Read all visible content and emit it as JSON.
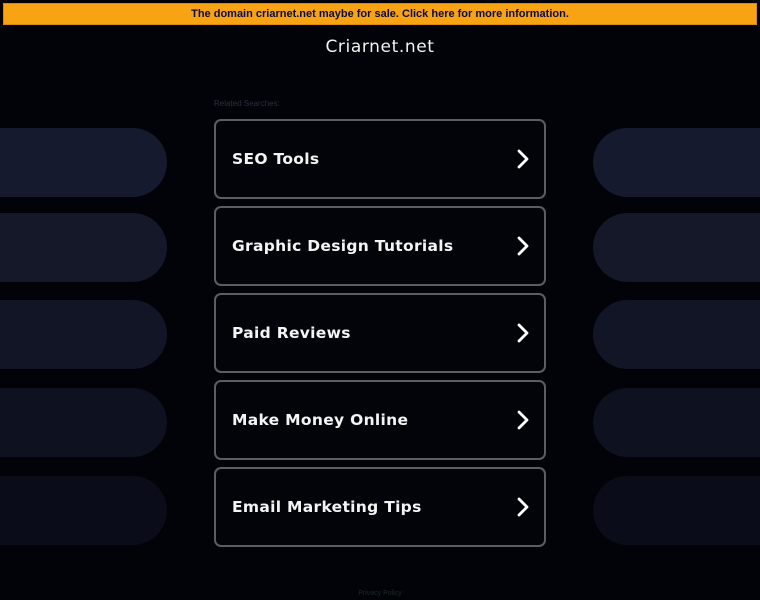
{
  "banner": {
    "text": "The domain criarnet.net maybe for sale. Click here for more information."
  },
  "site": {
    "title": "Criarnet.net"
  },
  "related": {
    "label": "Related Searches:"
  },
  "links": [
    {
      "label": "SEO Tools"
    },
    {
      "label": "Graphic Design Tutorials"
    },
    {
      "label": "Paid Reviews"
    },
    {
      "label": "Make Money Online"
    },
    {
      "label": "Email Marketing Tips"
    }
  ],
  "footer": {
    "text": "Privacy Policy"
  },
  "colors": {
    "background": "#020308",
    "banner": "#f7a313",
    "card_border": "#5c5d62",
    "decor": [
      "#161a2e",
      "#141829",
      "#111526",
      "#0e111f",
      "#0a0d19"
    ]
  },
  "icons": {
    "link_arrow": "chevron-right-icon"
  }
}
